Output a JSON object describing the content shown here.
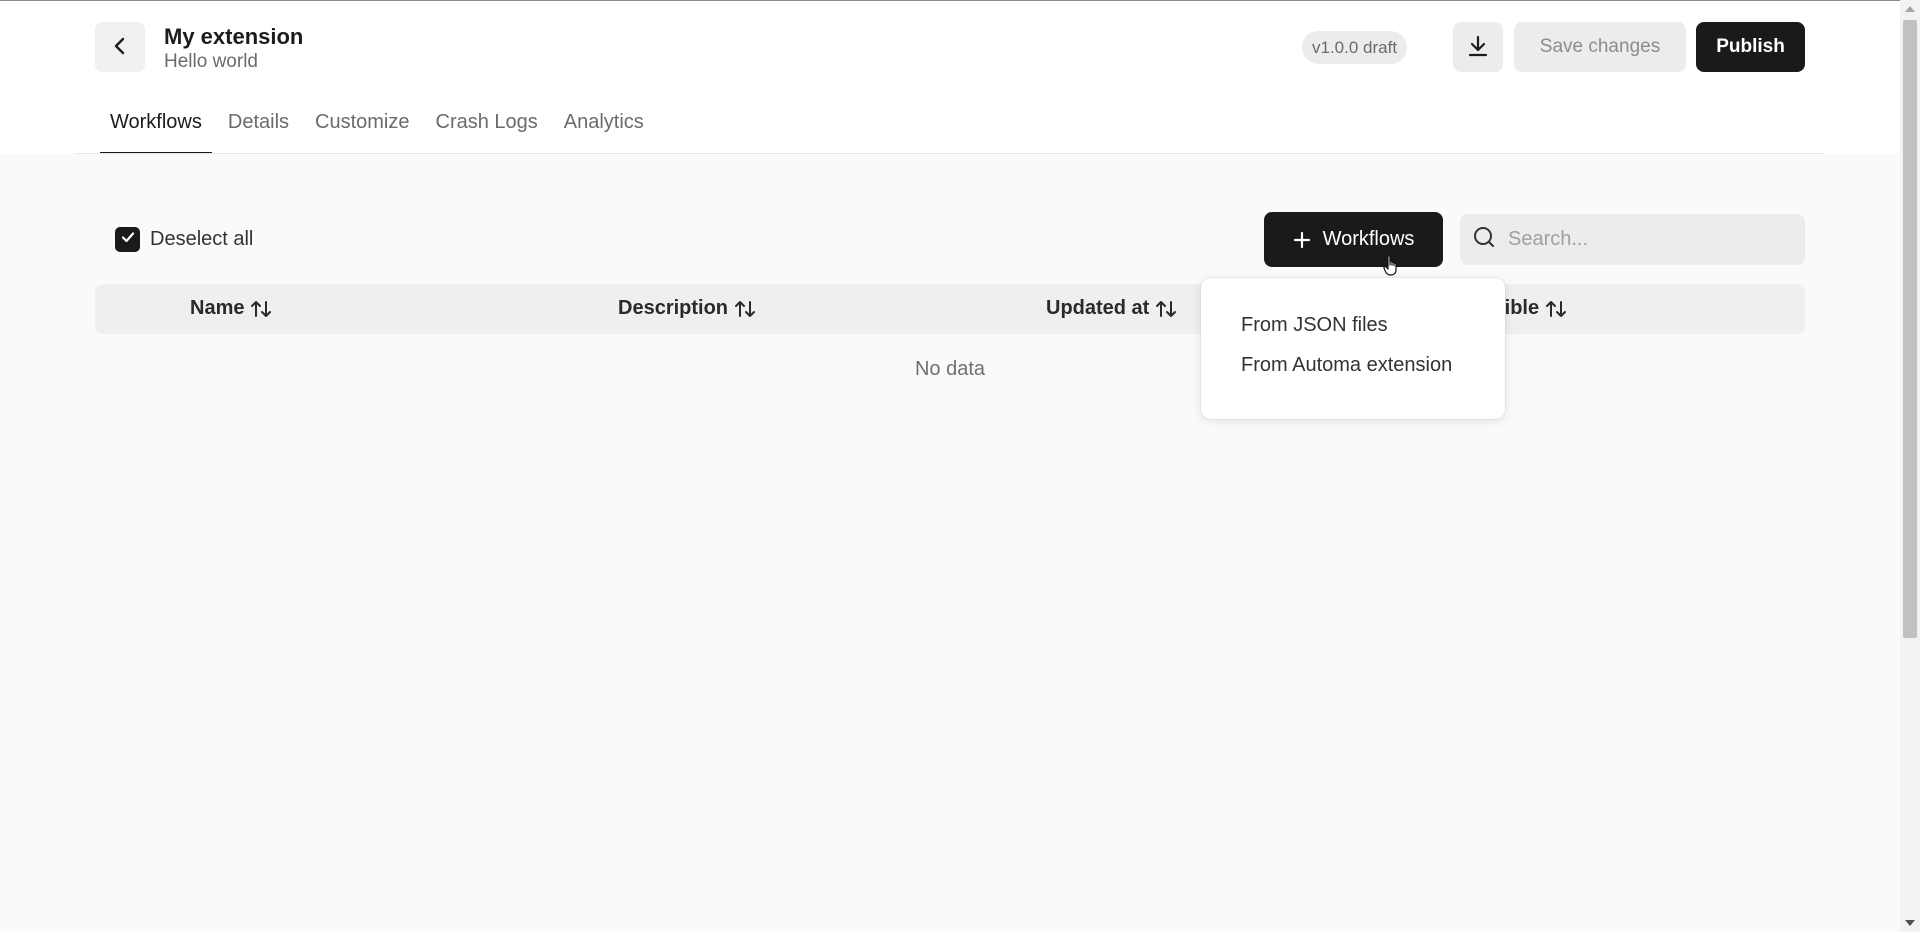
{
  "header": {
    "title": "My extension",
    "subtitle": "Hello world",
    "version_badge": "v1.0.0 draft",
    "save_label": "Save changes",
    "publish_label": "Publish"
  },
  "tabs": [
    {
      "label": "Workflows",
      "active": true
    },
    {
      "label": "Details",
      "active": false
    },
    {
      "label": "Customize",
      "active": false
    },
    {
      "label": "Crash Logs",
      "active": false
    },
    {
      "label": "Analytics",
      "active": false
    }
  ],
  "toolbar": {
    "deselect_label": "Deselect all",
    "deselect_checked": true,
    "add_button_label": "Workflows",
    "search_placeholder": "Search..."
  },
  "table": {
    "columns": [
      "Name",
      "Description",
      "Updated at",
      "Visible"
    ],
    "empty_text": "No data"
  },
  "dropdown": {
    "items": [
      "From JSON files",
      "From Automa extension"
    ]
  },
  "colors": {
    "primary": "#1a1a1a",
    "background": "#fafafa",
    "muted": "#ececec"
  },
  "icons": {
    "back": "chevron-left-icon",
    "download": "download-icon",
    "add": "plus-icon",
    "search": "search-icon",
    "sort": "sort-arrows-icon",
    "check": "check-icon"
  }
}
